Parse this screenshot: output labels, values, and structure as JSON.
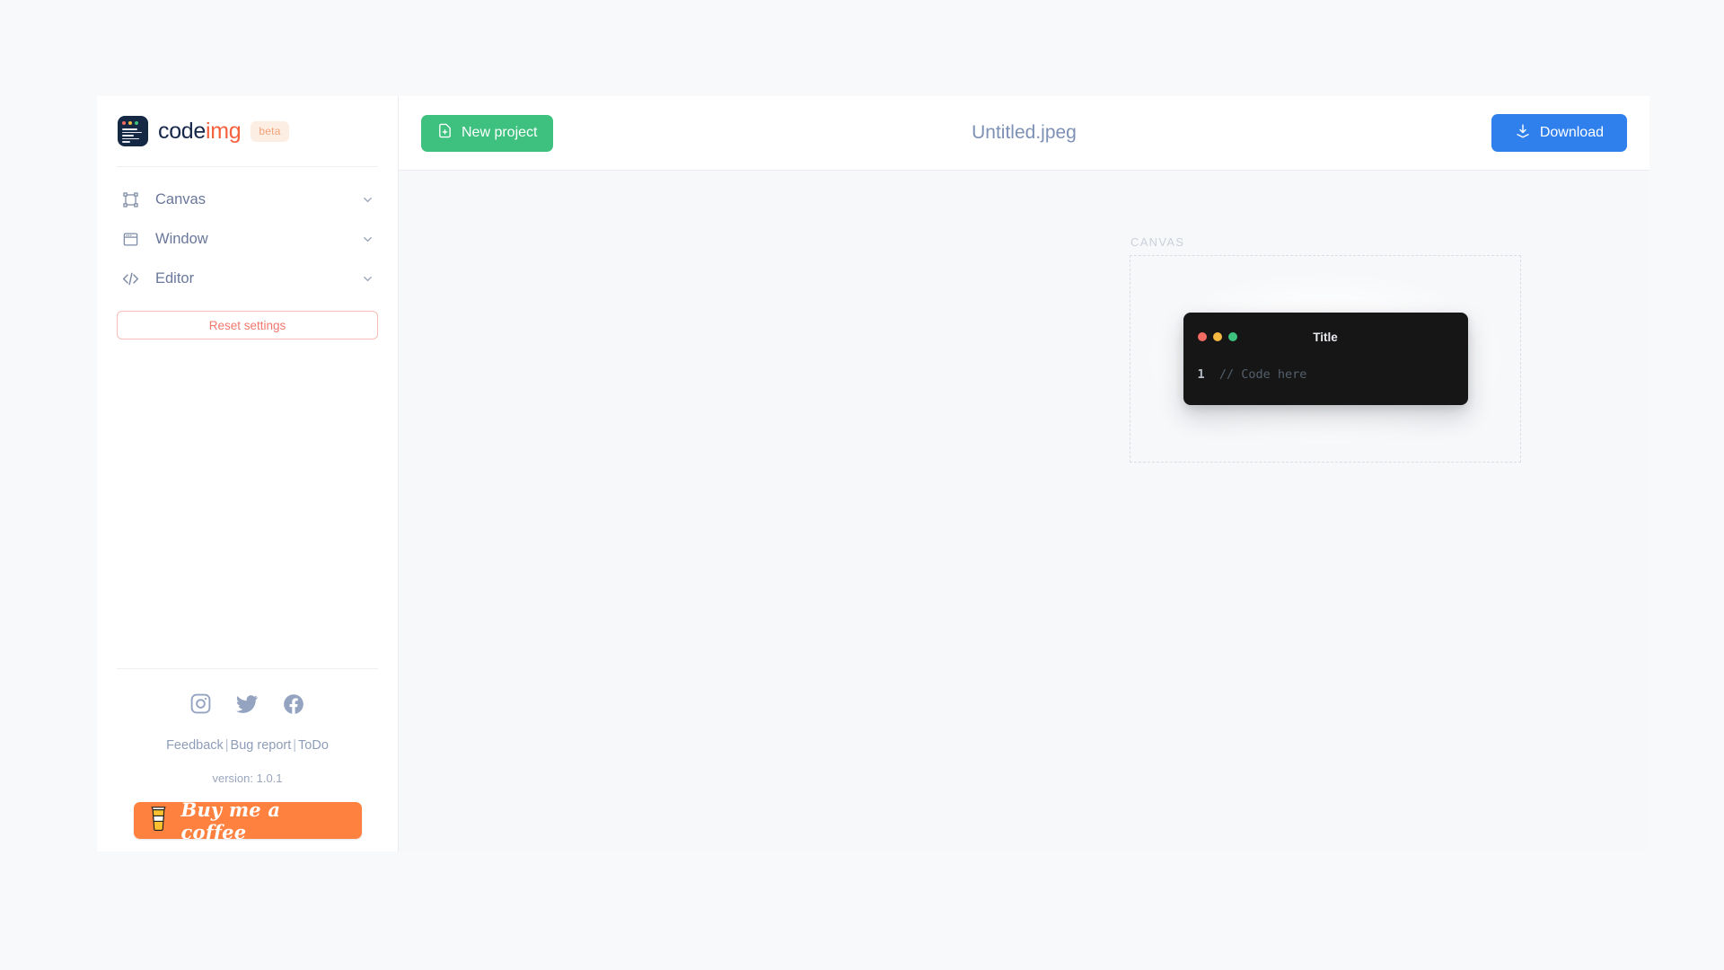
{
  "app": {
    "logo": {
      "text_primary": "code",
      "text_accent": "img",
      "badge": "beta",
      "icon": "codeimg-logo-icon"
    }
  },
  "sidebar": {
    "menu": [
      {
        "label": "Canvas",
        "icon": "transform-frame-icon",
        "chevron": "chevron-down-icon"
      },
      {
        "label": "Window",
        "icon": "browser-window-icon",
        "chevron": "chevron-down-icon"
      },
      {
        "label": "Editor",
        "icon": "code-brackets-icon",
        "chevron": "chevron-down-icon"
      }
    ],
    "reset_label": "Reset settings",
    "socials": [
      {
        "name": "instagram-icon"
      },
      {
        "name": "twitter-icon"
      },
      {
        "name": "facebook-icon"
      }
    ],
    "links": {
      "feedback": "Feedback",
      "bug_report": "Bug report",
      "todo": "ToDo",
      "separator": "|"
    },
    "version": "version: 1.0.1",
    "coffee_label": "Buy me a coffee"
  },
  "topbar": {
    "new_project_label": "New project",
    "new_project_icon": "file-plus-icon",
    "document_title": "Untitled.jpeg",
    "download_label": "Download",
    "download_icon": "download-icon"
  },
  "canvas": {
    "label": "CANVAS",
    "code_window": {
      "title": "Title",
      "line_number": "1",
      "code_text": "// Code here",
      "dots": [
        "#f46b63",
        "#f5b841",
        "#3ec17f"
      ]
    }
  },
  "colors": {
    "page_background": "#f8f9fb",
    "sidebar_background": "#ffffff",
    "workspace_background": "#f7f8fa",
    "accent_green": "#3ec17f",
    "accent_blue": "#2f80ed",
    "accent_red": "#f1776e",
    "accent_orange": "#ff813f",
    "logo_navy": "#16274a",
    "logo_coral": "#f4613f",
    "code_window_bg": "#161616"
  }
}
